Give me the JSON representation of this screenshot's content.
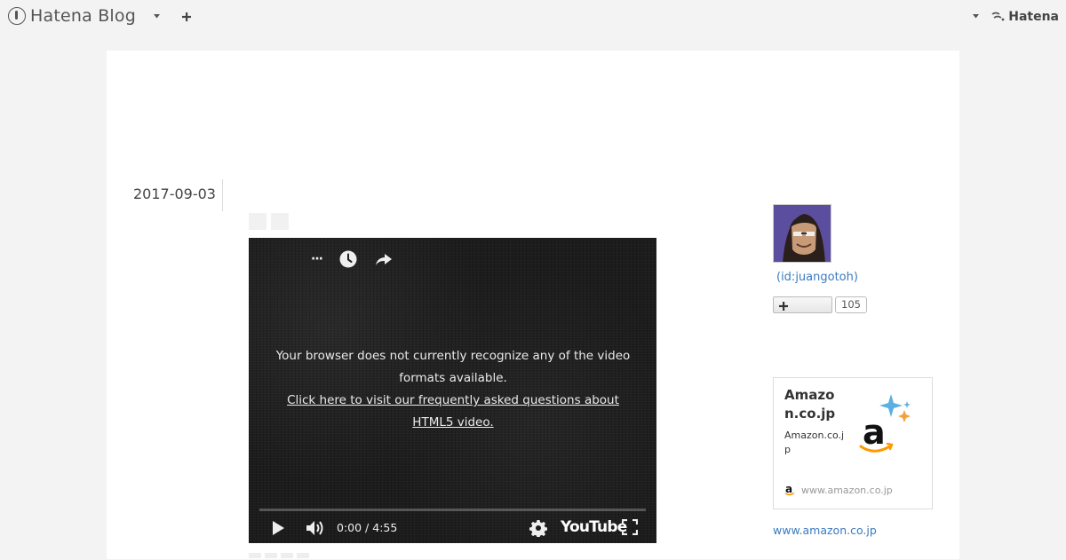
{
  "globalbar": {
    "logo_text": "Hatena Blog",
    "right_brand": "Hatena"
  },
  "entry": {
    "date": "2017-09-03"
  },
  "video": {
    "message_line": "Your browser does not currently recognize any of the video formats available.",
    "faq_link": "Click here to visit our frequently asked questions about HTML5 video.",
    "time_current": "0:00",
    "time_separator": " / ",
    "time_total": "4:55",
    "progress": 0,
    "brand": "YouTube"
  },
  "sidebar": {
    "profile_id": "(id:juangotoh)",
    "subscribe_count": "105",
    "amazon_card": {
      "title": "Amazon.co.jp",
      "description": "Amazon.co.jp",
      "site": "www.amazon.co.jp"
    },
    "amazon_link": "www.amazon.co.jp"
  },
  "colors": {
    "page_bg": "#f3f3f3",
    "panel_bg": "#ffffff",
    "link": "#3b7bbf",
    "video_bg": "#1c1c1c",
    "amazon_orange": "#f90"
  },
  "icons": {
    "logo": "hatena-blog-logo-icon",
    "caret": "caret-down-icon",
    "plus": "plus-icon",
    "hatena": "hatena-logo-icon",
    "watch_later": "clock-icon",
    "share": "share-arrow-icon",
    "play": "play-icon",
    "volume": "volume-icon",
    "settings": "gear-icon",
    "fullscreen": "fullscreen-icon",
    "amazon": "amazon-logo-icon"
  }
}
